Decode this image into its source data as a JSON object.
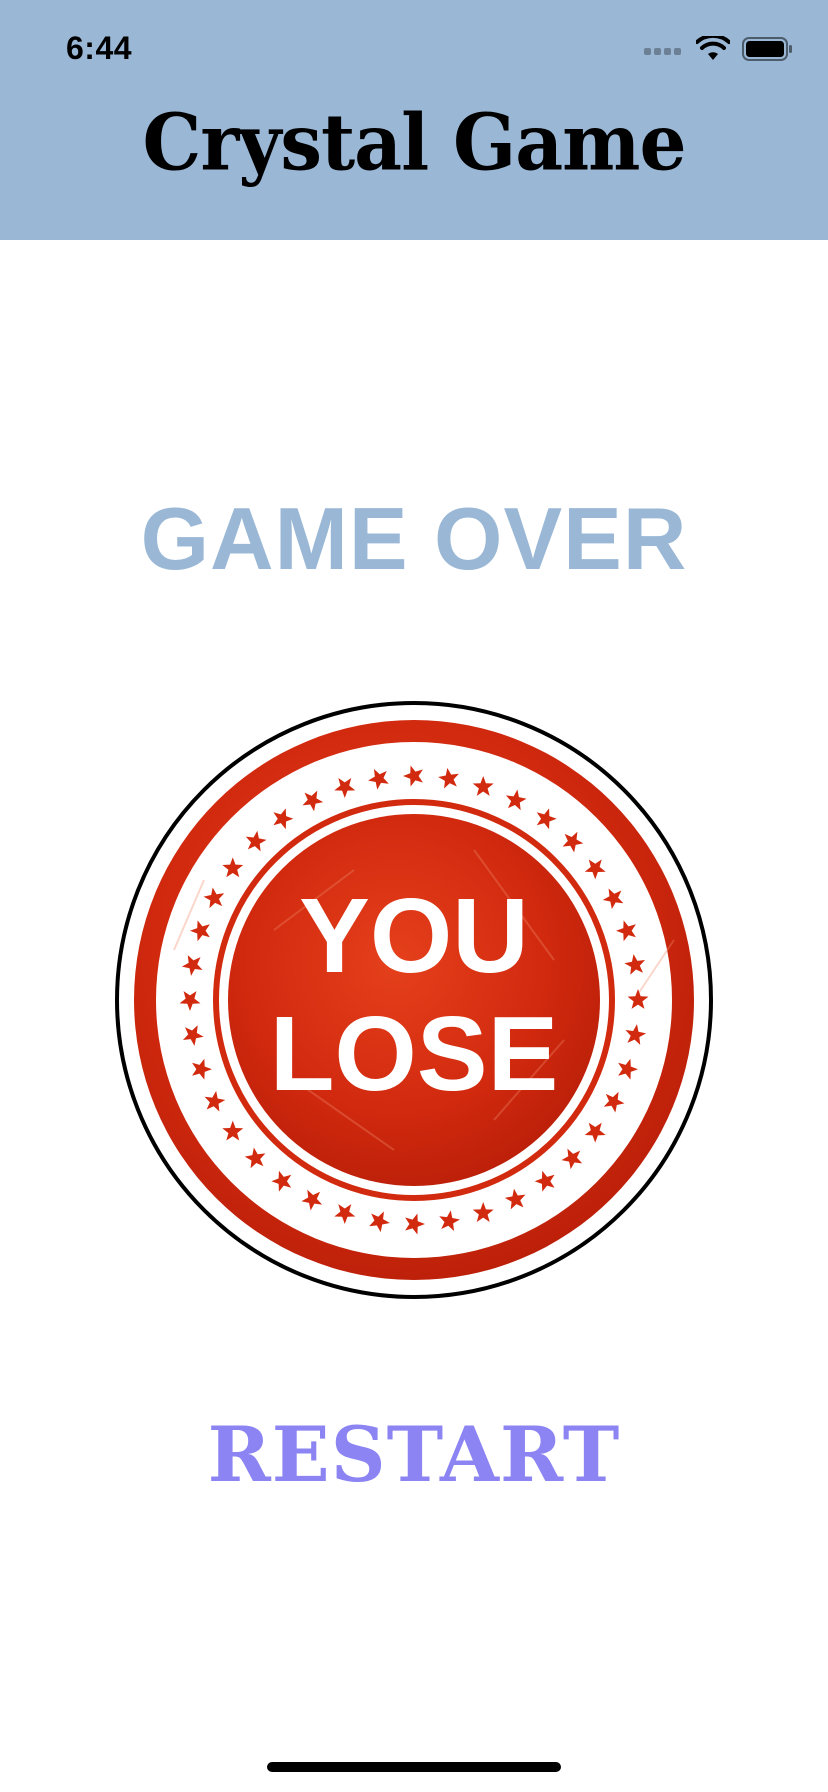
{
  "status_bar": {
    "time": "6:44",
    "icons": [
      "cellular-signal-icon",
      "wifi-icon",
      "battery-icon"
    ]
  },
  "header": {
    "title": "Crystal Game",
    "background_color": "#9ab8d6"
  },
  "main": {
    "game_over_label": "GAME OVER",
    "game_over_color": "#9ab8d6",
    "stamp": {
      "line1": "YOU",
      "line2": "LOSE",
      "color": "#d32a10"
    },
    "restart_label": "RESTART",
    "restart_color": "#8b84f2"
  }
}
